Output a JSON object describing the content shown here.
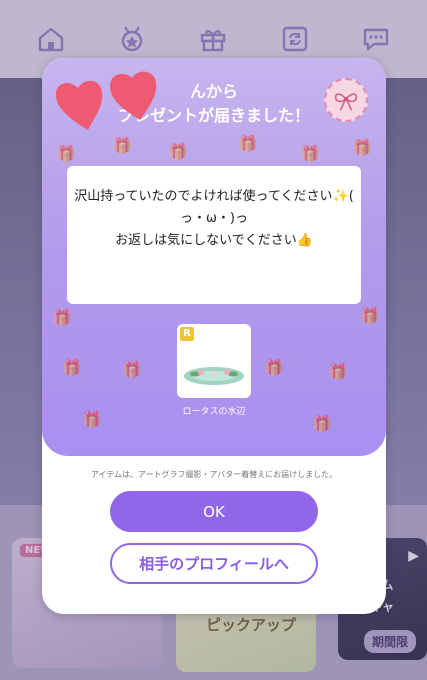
{
  "nav": {
    "icons": [
      "house-icon",
      "badge-icon",
      "gift-icon",
      "refresh-icon",
      "chat-icon"
    ]
  },
  "background": {
    "new_tag": "NEW",
    "pick_tag": "ピックアップ",
    "right_line1": "キングム",
    "right_line2": "投稿キャ",
    "right_badge": "期間限"
  },
  "modal": {
    "title_line1": "んから",
    "title_line2": "プレゼントが届きました！",
    "message_line1": "沢山持っていたのでよければ使ってください✨(",
    "message_line2": "っ・ω・)っ",
    "message_line3": "お返しは気にしないでください👍",
    "item": {
      "rarity": "R",
      "name": "ロータスの水辺"
    },
    "note": "アイテムは、アートグラフ撮影・アバター着替えにお届けしました。",
    "ok_label": "OK",
    "profile_label": "相手のプロフィールへ"
  },
  "colors": {
    "accent": "#9266e8",
    "modal_header": "#b39ceb",
    "nav_icon": "#9b86c9"
  }
}
